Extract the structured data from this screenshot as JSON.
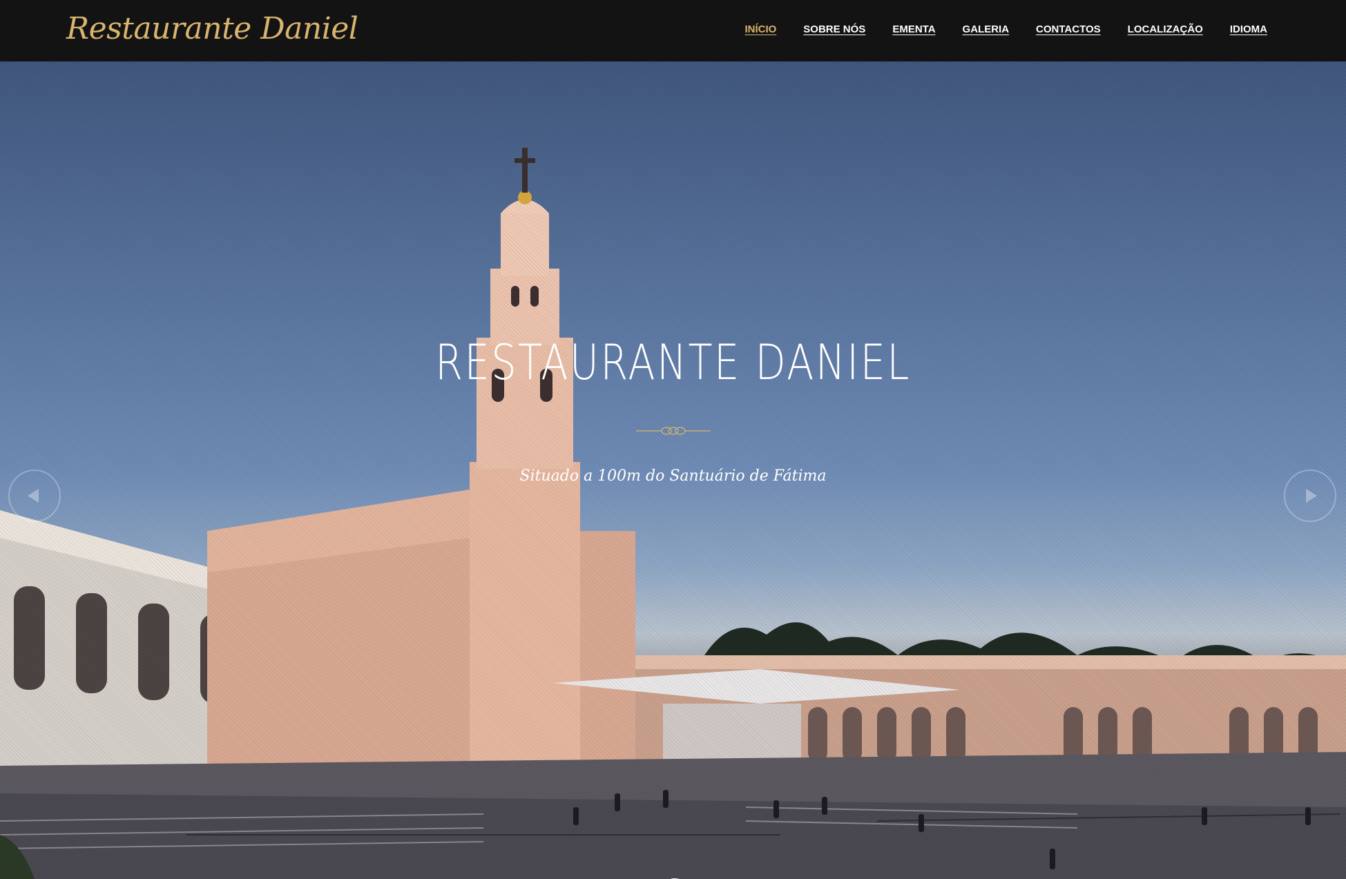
{
  "navbar": {
    "brand": "Restaurante Daniel",
    "items": [
      {
        "label": "INÍCIO",
        "active": true
      },
      {
        "label": "SOBRE NÓS",
        "active": false
      },
      {
        "label": "EMENTA",
        "active": false
      },
      {
        "label": "GALERIA",
        "active": false
      },
      {
        "label": "CONTACTOS",
        "active": false
      },
      {
        "label": "LOCALIZAÇÃO",
        "active": false
      },
      {
        "label": "IDIOMA",
        "active": false
      }
    ]
  },
  "hero": {
    "title": "RESTAURANTE DANIEL",
    "subtitle": "Situado a 100m do Santuário de Fátima",
    "prev_icon": "chevron-left-icon",
    "next_icon": "chevron-right-icon",
    "scroll_icon": "circle-icon"
  },
  "colors": {
    "navbar_bg": "#141314",
    "accent": "#d8b56e",
    "text": "#ffffff"
  }
}
